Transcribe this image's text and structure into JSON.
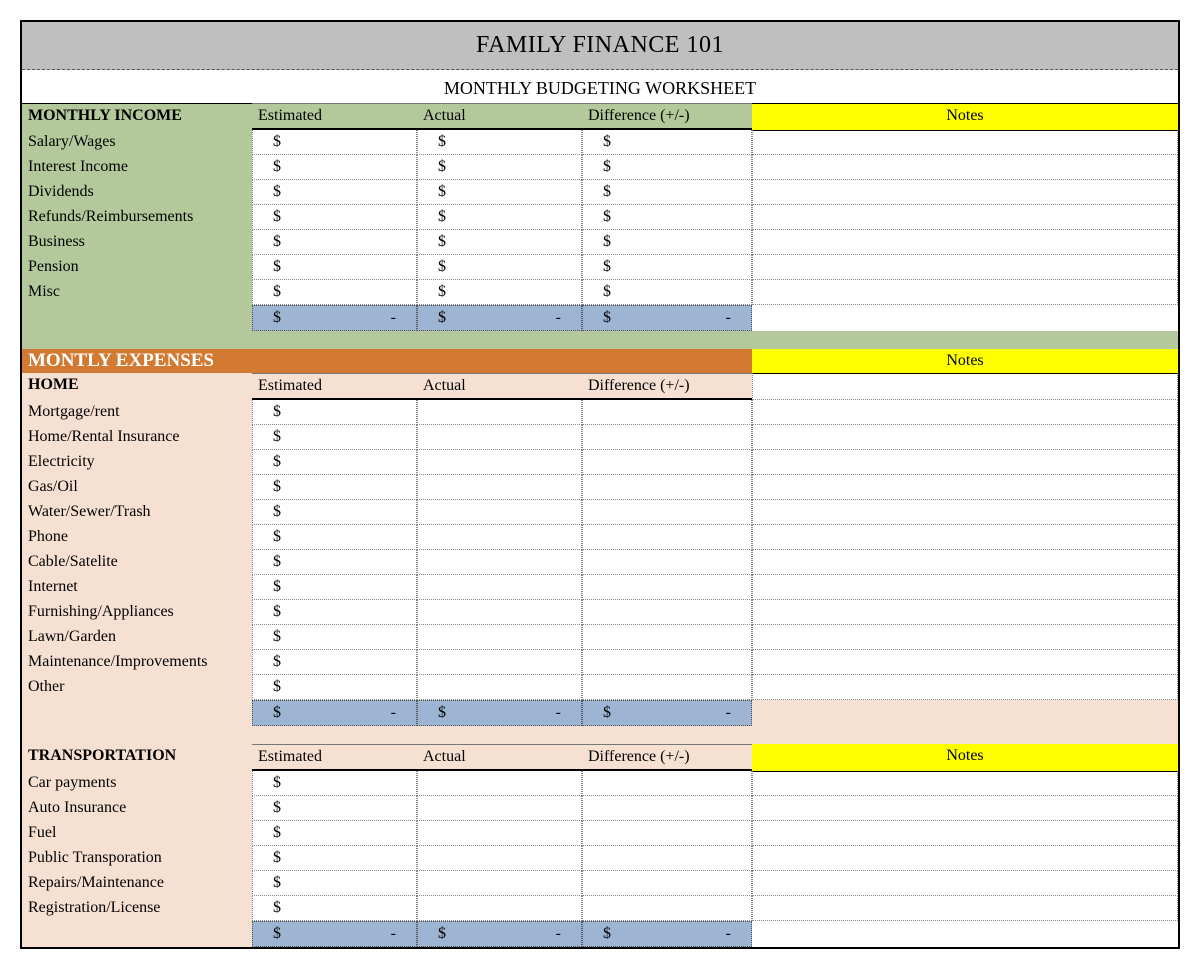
{
  "title": "FAMILY FINANCE 101",
  "subtitle": "MONTHLY BUDGETING WORKSHEET",
  "columns": {
    "estimated": "Estimated",
    "actual": "Actual",
    "difference": "Difference (+/-)",
    "notes": "Notes"
  },
  "currency": "$",
  "zero": "- ",
  "income": {
    "heading": "MONTHLY INCOME",
    "rows": [
      "Salary/Wages",
      "Interest Income",
      "Dividends",
      "Refunds/Reimbursements",
      "Business",
      "Pension",
      "Misc"
    ]
  },
  "expenses": {
    "heading": "MONTLY EXPENSES",
    "home": {
      "heading": "HOME",
      "rows": [
        "Mortgage/rent",
        "Home/Rental Insurance",
        "Electricity",
        "Gas/Oil",
        "Water/Sewer/Trash",
        "Phone",
        "Cable/Satelite",
        "Internet",
        "Furnishing/Appliances",
        "Lawn/Garden",
        "Maintenance/Improvements",
        "Other"
      ]
    },
    "transportation": {
      "heading": "TRANSPORTATION",
      "rows": [
        "Car payments",
        "Auto Insurance",
        "Fuel",
        "Public Transporation",
        "Repairs/Maintenance",
        "Registration/License"
      ]
    }
  }
}
